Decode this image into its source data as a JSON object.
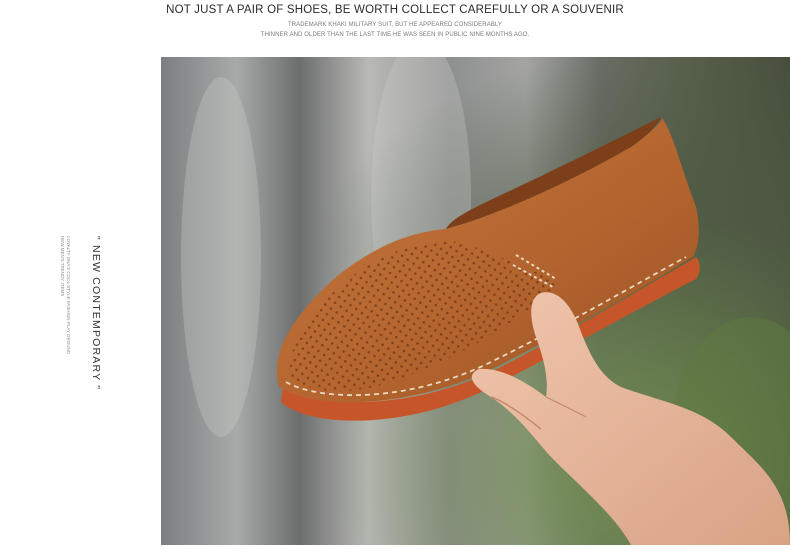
{
  "header": {
    "headline": "NOT JUST A PAIR OF SHOES, BE WORTH COLLECT CAREFULLY OR A SOUVENIR",
    "subline_1": "TRADEMARK KHAKI MILITARY SUIT, BUT HE APPEARED CONSIDERABLY",
    "subline_2": "THINNER AND OLDER THAN THE LAST TIME HE WAS SEEN IN PUBLIC NINE MONTHS AGO."
  },
  "side": {
    "title": "\" NEW CONTEMPORARY \"",
    "small_line_1": "LOYALTY DNA'S COOL STYLE FASHION PLAY GROUND",
    "small_line_2": "NEW MEN'S TRENDY ITEMS"
  },
  "photo": {
    "subject": "brown perforated leather loafer held in hand",
    "colors": {
      "leather": "#b86a35",
      "sole": "#c6562a",
      "stitch": "#ead9c2",
      "skin": "#e4b69d"
    }
  }
}
